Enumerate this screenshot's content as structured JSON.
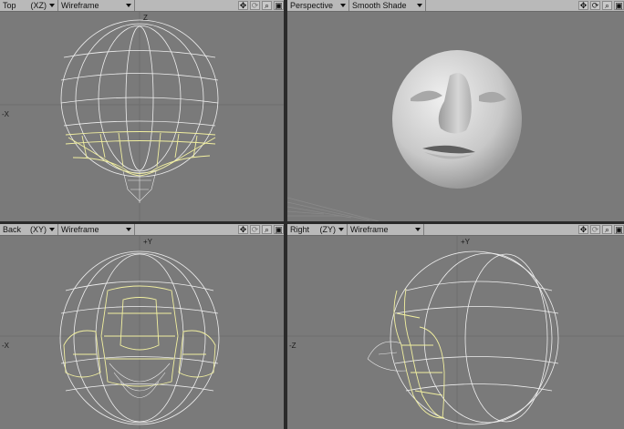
{
  "viewports": {
    "top": {
      "name": "Top",
      "axes": "(XZ)",
      "mode": "Wireframe",
      "axis_left": "-X",
      "axis_top": "Z"
    },
    "perspective": {
      "name": "Perspective",
      "mode": "Smooth Shade"
    },
    "back": {
      "name": "Back",
      "axes": "(XY)",
      "mode": "Wireframe",
      "axis_left": "-X",
      "axis_top": "+Y"
    },
    "right": {
      "name": "Right",
      "axes": "(ZY)",
      "mode": "Wireframe",
      "axis_left": "-Z",
      "axis_top": "+Y"
    }
  },
  "toolbar_icons": [
    "move-icon",
    "rotate-icon",
    "zoom-icon",
    "maximize-icon"
  ],
  "colors": {
    "viewport_bg": "#7a7a7a",
    "header_bg": "#b9b9b9",
    "divider": "#2a2a2a",
    "wire": "#efefef",
    "selected_wire": "#f2f0a0",
    "shaded_face": "#d7d7d7"
  }
}
